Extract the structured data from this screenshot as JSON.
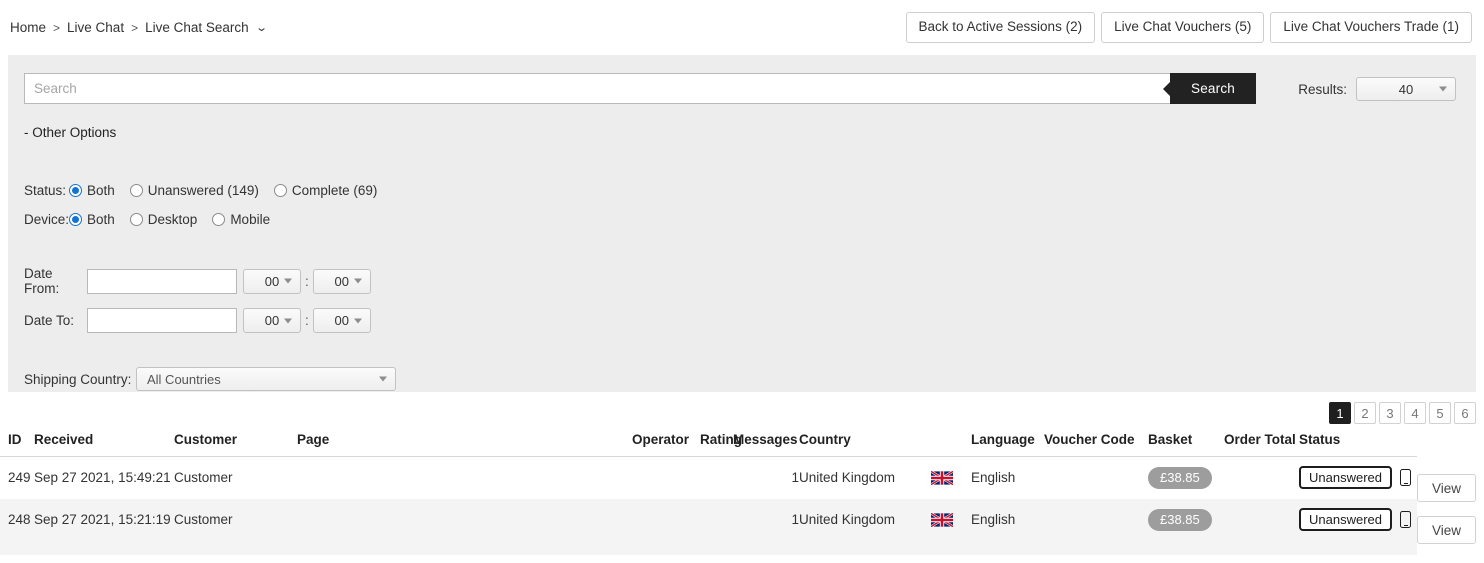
{
  "breadcrumb": {
    "items": [
      "Home",
      "Live Chat",
      "Live Chat Search"
    ],
    "separator": ">",
    "caret": "⌄"
  },
  "header": {
    "buttons": [
      {
        "label": "Back to Active Sessions (2)",
        "name": "back-to-active-sessions-button"
      },
      {
        "label": "Live Chat Vouchers (5)",
        "name": "live-chat-vouchers-button"
      },
      {
        "label": "Live Chat Vouchers Trade (1)",
        "name": "live-chat-vouchers-trade-button"
      }
    ]
  },
  "search": {
    "placeholder": "Search",
    "value": "",
    "button_label": "Search",
    "results_label": "Results:",
    "results_value": "40"
  },
  "filters": {
    "other_options_label": "- Other Options",
    "status": {
      "label": "Status:",
      "options": [
        {
          "label": "Both",
          "checked": true
        },
        {
          "label": "Unanswered (149)",
          "checked": false
        },
        {
          "label": "Complete (69)",
          "checked": false
        }
      ]
    },
    "device": {
      "label": "Device:",
      "options": [
        {
          "label": "Both",
          "checked": true
        },
        {
          "label": "Desktop",
          "checked": false
        },
        {
          "label": "Mobile",
          "checked": false
        }
      ]
    },
    "date_from": {
      "label": "Date From:",
      "value": "",
      "hour": "00",
      "minute": "00",
      "separator": ":"
    },
    "date_to": {
      "label": "Date To:",
      "value": "",
      "hour": "00",
      "minute": "00",
      "separator": ":"
    },
    "shipping_country": {
      "label": "Shipping Country:",
      "value": "All Countries"
    }
  },
  "pagination": {
    "pages": [
      "1",
      "2",
      "3",
      "4",
      "5",
      "6"
    ],
    "active": "1"
  },
  "table": {
    "columns": [
      "ID",
      "Received",
      "Customer",
      "Page",
      "Operator",
      "Rating",
      "Messages",
      "Country",
      "Language",
      "Voucher Code",
      "Basket",
      "Order Total",
      "Status"
    ],
    "rows": [
      {
        "id": "249",
        "received": "Sep 27 2021, 15:49:21",
        "customer": "Customer",
        "page": "",
        "operator": "",
        "rating": "",
        "messages": "1",
        "country": "United Kingdom",
        "flag": "uk-flag-icon",
        "language": "English",
        "voucher_code": "",
        "basket": "£38.85",
        "order_total": "",
        "status": "Unanswered",
        "device": "mobile-device-icon",
        "action": "View"
      },
      {
        "id": "248",
        "received": "Sep 27 2021, 15:21:19",
        "customer": "Customer",
        "page": "",
        "operator": "",
        "rating": "",
        "messages": "1",
        "country": "United Kingdom",
        "flag": "uk-flag-icon",
        "language": "English",
        "voucher_code": "",
        "basket": "£38.85",
        "order_total": "",
        "status": "Unanswered",
        "device": "mobile-device-icon",
        "action": "View"
      }
    ]
  },
  "colors": {
    "accent_dark": "#222222",
    "radio_blue": "#1273d4",
    "panel_bg": "#ededed",
    "basket_pill": "#9d9d9d",
    "row_alt": "#f4f4f4"
  }
}
